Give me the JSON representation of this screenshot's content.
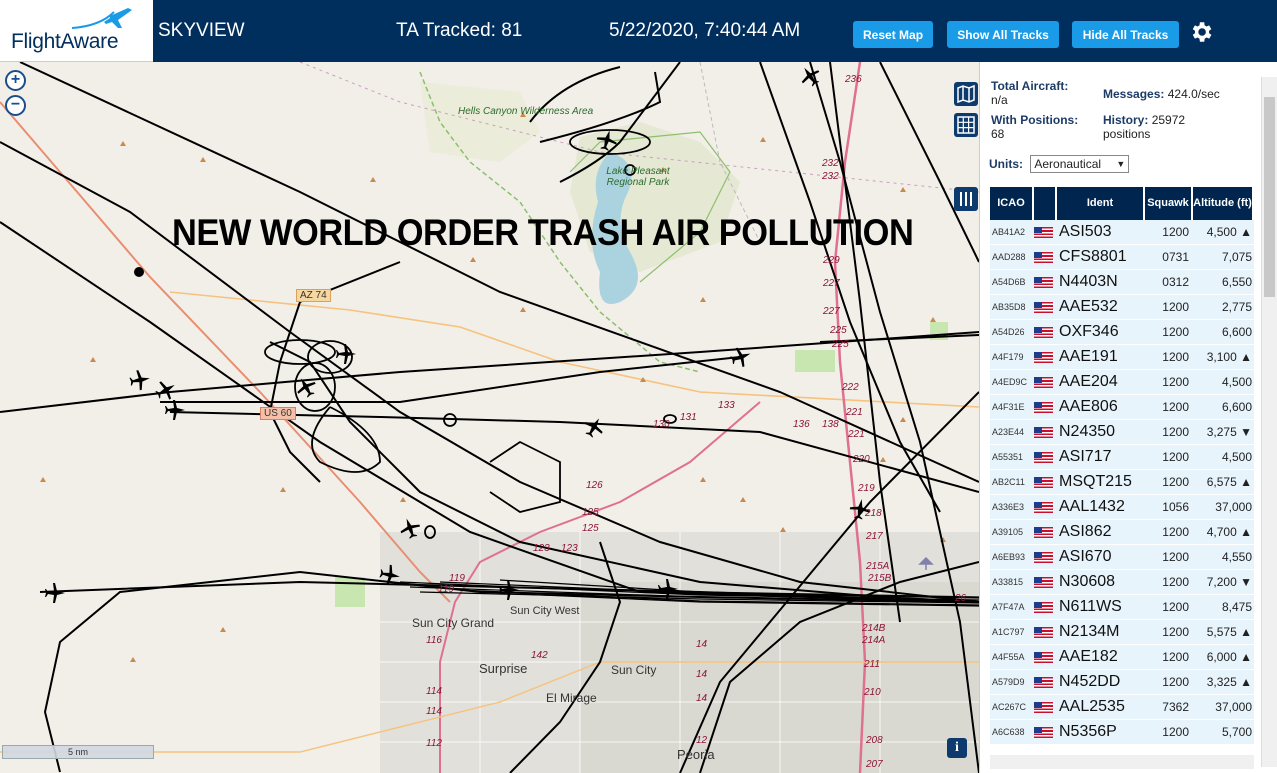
{
  "header": {
    "logo_text": "FlightAware",
    "app_name": "SKYVIEW",
    "ta_tracked": "TA Tracked: 81",
    "clock": "5/22/2020, 7:40:44 AM",
    "buttons": {
      "reset": "Reset Map",
      "show": "Show All Tracks",
      "hide": "Hide All Tracks"
    },
    "brand_color": "#002F5D",
    "button_color": "#1a9be8"
  },
  "map": {
    "overlay_caption": "NEW WORLD ORDER TRASH AIR POLLUTION",
    "scale_label": "5 nm",
    "zoom_in": "+",
    "zoom_out": "−",
    "info_label": "i",
    "places": {
      "hells_canyon": "Hells Canyon Wilderness Area",
      "lake_pleasant": "Lake Pleasant Regional Park",
      "sun_city_grand": "Sun City Grand",
      "sun_city_west": "Sun City West",
      "sun_city": "Sun City",
      "surprise": "Surprise",
      "el_mirage": "El Mirage",
      "peoria": "Peoria",
      "az74": "AZ 74",
      "us60": "US 60"
    },
    "road_numbers": [
      "236",
      "232",
      "232",
      "229",
      "227",
      "227",
      "225",
      "225",
      "222",
      "221",
      "221",
      "220",
      "219",
      "218",
      "217",
      "215A",
      "215B",
      "214B",
      "214A",
      "211",
      "210",
      "208",
      "207",
      "142",
      "131",
      "130",
      "133",
      "136",
      "126",
      "125",
      "125",
      "123",
      "123",
      "119",
      "116",
      "114",
      "114",
      "112",
      "119",
      "14",
      "14",
      "14",
      "12",
      "26",
      "138"
    ]
  },
  "sidebar": {
    "total_aircraft_label": "Total Aircraft:",
    "total_aircraft_value": "n/a",
    "messages_label": "Messages:",
    "messages_value": "424.0/sec",
    "with_positions_label": "With Positions:",
    "with_positions_value": "68",
    "history_label": "History:",
    "history_value": "25972 positions",
    "units_label": "Units:",
    "units_value": "Aeronautical",
    "columns": {
      "icao": "ICAO",
      "ident": "Ident",
      "squawk": "Squawk",
      "altitude": "Altitude (ft)"
    },
    "rows": [
      {
        "icao": "AB41A2",
        "ident": "ASI503",
        "squawk": "1200",
        "alt": "4,500 ▲"
      },
      {
        "icao": "AAD288",
        "ident": "CFS8801",
        "squawk": "0731",
        "alt": "7,075"
      },
      {
        "icao": "A54D6B",
        "ident": "N4403N",
        "squawk": "0312",
        "alt": "6,550"
      },
      {
        "icao": "AB35D8",
        "ident": "AAE532",
        "squawk": "1200",
        "alt": "2,775"
      },
      {
        "icao": "A54D26",
        "ident": "OXF346",
        "squawk": "1200",
        "alt": "6,600"
      },
      {
        "icao": "A4F179",
        "ident": "AAE191",
        "squawk": "1200",
        "alt": "3,100 ▲"
      },
      {
        "icao": "A4ED9C",
        "ident": "AAE204",
        "squawk": "1200",
        "alt": "4,500"
      },
      {
        "icao": "A4F31E",
        "ident": "AAE806",
        "squawk": "1200",
        "alt": "6,600"
      },
      {
        "icao": "A23E44",
        "ident": "N24350",
        "squawk": "1200",
        "alt": "3,275 ▼"
      },
      {
        "icao": "A55351",
        "ident": "ASI717",
        "squawk": "1200",
        "alt": "4,500"
      },
      {
        "icao": "AB2C11",
        "ident": "MSQT215",
        "squawk": "1200",
        "alt": "6,575 ▲"
      },
      {
        "icao": "A336E3",
        "ident": "AAL1432",
        "squawk": "1056",
        "alt": "37,000"
      },
      {
        "icao": "A39105",
        "ident": "ASI862",
        "squawk": "1200",
        "alt": "4,700 ▲"
      },
      {
        "icao": "A6EB93",
        "ident": "ASI670",
        "squawk": "1200",
        "alt": "4,550"
      },
      {
        "icao": "A33815",
        "ident": "N30608",
        "squawk": "1200",
        "alt": "7,200 ▼"
      },
      {
        "icao": "A7F47A",
        "ident": "N611WS",
        "squawk": "1200",
        "alt": "8,475"
      },
      {
        "icao": "A1C797",
        "ident": "N2134M",
        "squawk": "1200",
        "alt": "5,575 ▲"
      },
      {
        "icao": "A4F55A",
        "ident": "AAE182",
        "squawk": "1200",
        "alt": "6,000 ▲"
      },
      {
        "icao": "A579D9",
        "ident": "N452DD",
        "squawk": "1200",
        "alt": "3,325 ▲"
      },
      {
        "icao": "AC267C",
        "ident": "AAL2535",
        "squawk": "7362",
        "alt": "37,000"
      },
      {
        "icao": "A6C638",
        "ident": "N5356P",
        "squawk": "1200",
        "alt": "5,700"
      }
    ]
  }
}
